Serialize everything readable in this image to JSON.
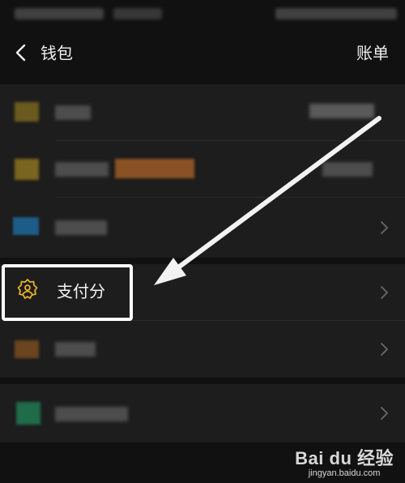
{
  "navbar": {
    "title": "钱包",
    "bill_label": "账单"
  },
  "score": {
    "label": "支付分"
  },
  "colors": {
    "background": "#111111",
    "section_bg": "#1d1d1d",
    "score_icon": "#e8b12a",
    "highlight": "#ffffff"
  },
  "icons": [
    "chevron-left-icon",
    "chevron-right-icon",
    "shield-person-icon"
  ],
  "watermark": {
    "main": "Bai du 经验",
    "sub": "jingyan.baidu.com"
  }
}
